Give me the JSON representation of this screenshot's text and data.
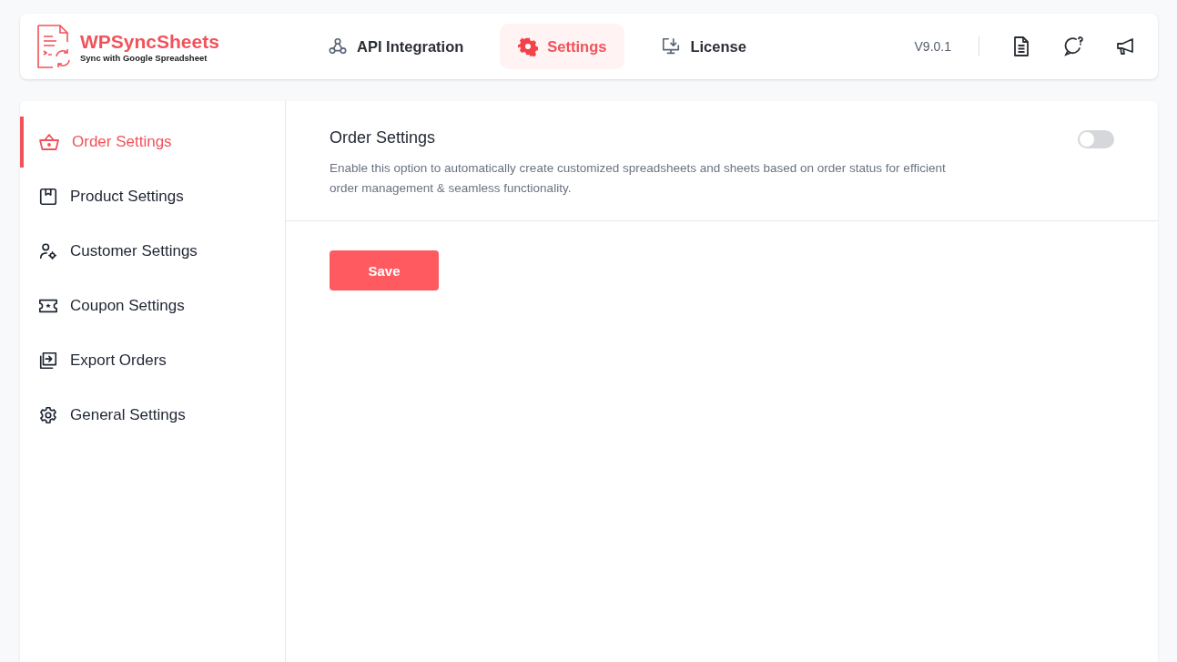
{
  "logo": {
    "name": "WPSyncSheets",
    "tagline": "Sync with Google Spreadsheet"
  },
  "tabs": [
    {
      "label": "API Integration",
      "selected": false
    },
    {
      "label": "Settings",
      "selected": true
    },
    {
      "label": "License",
      "selected": false
    }
  ],
  "version": "V9.0.1",
  "sidebar": {
    "items": [
      {
        "label": "Order Settings",
        "selected": true
      },
      {
        "label": "Product Settings",
        "selected": false
      },
      {
        "label": "Customer Settings",
        "selected": false
      },
      {
        "label": "Coupon Settings",
        "selected": false
      },
      {
        "label": "Export Orders",
        "selected": false
      },
      {
        "label": "General Settings",
        "selected": false
      }
    ]
  },
  "setting": {
    "title": "Order Settings",
    "description": "Enable this option to automatically create customized spreadsheets and sheets based on order status for efficient order management & seamless functionality.",
    "on": false
  },
  "save_button": "Save"
}
